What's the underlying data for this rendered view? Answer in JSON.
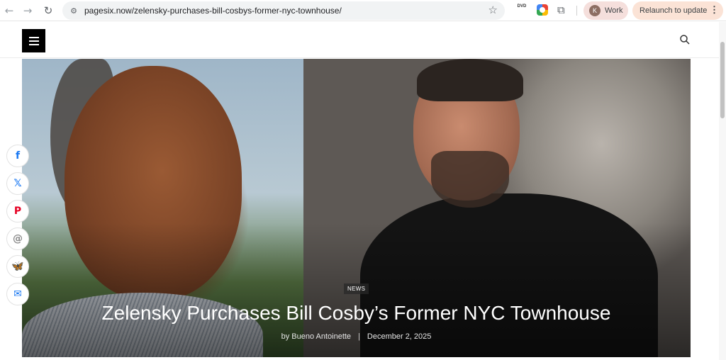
{
  "browser": {
    "url": "pagesix.now/zelensky-purchases-bill-cosbys-former-nyc-townhouse/",
    "profile_name": "Work",
    "profile_initial": "K",
    "relaunch_label": "Relaunch to update",
    "extension_dvd_label": "DVD"
  },
  "article": {
    "category": "NEWS",
    "headline": "Zelensky Purchases Bill Cosby’s Former NYC Townhouse",
    "author": "by Bueno Antoinette",
    "separator": "|",
    "date": "December 2, 2025"
  },
  "share_buttons": [
    {
      "icon": "facebook-icon",
      "glyph": "f",
      "color": "#1877f2"
    },
    {
      "icon": "x-icon",
      "glyph": "𝕏",
      "color": "#1877f2"
    },
    {
      "icon": "pinterest-icon",
      "glyph": "P",
      "color": "#e60023"
    },
    {
      "icon": "threads-icon",
      "glyph": "@",
      "color": "#888888"
    },
    {
      "icon": "bluesky-icon",
      "glyph": "🦋",
      "color": "#1185fe"
    },
    {
      "icon": "email-icon",
      "glyph": "✉",
      "color": "#1877f2"
    }
  ]
}
